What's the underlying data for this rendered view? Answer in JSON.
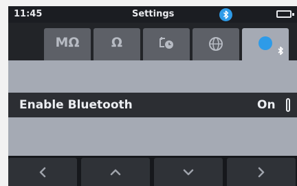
{
  "status_bar": {
    "time": "11:45",
    "title": "Settings",
    "bluetooth_icon": "bluetooth-icon",
    "battery_icon": "battery-icon"
  },
  "tabs": [
    {
      "label": "MΩ",
      "icon": null,
      "active": false
    },
    {
      "label": "Ω",
      "icon": null,
      "active": false
    },
    {
      "label": "",
      "icon": "timer-settings-icon",
      "active": false
    },
    {
      "label": "",
      "icon": "globe-icon",
      "active": false
    },
    {
      "label": "",
      "icon": "bluetooth-icon",
      "active": true
    }
  ],
  "setting": {
    "label": "Enable Bluetooth",
    "value": "On"
  },
  "nav_buttons": [
    {
      "icon": "chevron-left-icon"
    },
    {
      "icon": "chevron-up-icon"
    },
    {
      "icon": "chevron-down-icon"
    },
    {
      "icon": "chevron-right-icon"
    }
  ],
  "colors": {
    "accent_bluetooth": "#2e9be8",
    "screen_background": "#a5aab4",
    "bar_dark": "#1b1d22"
  }
}
